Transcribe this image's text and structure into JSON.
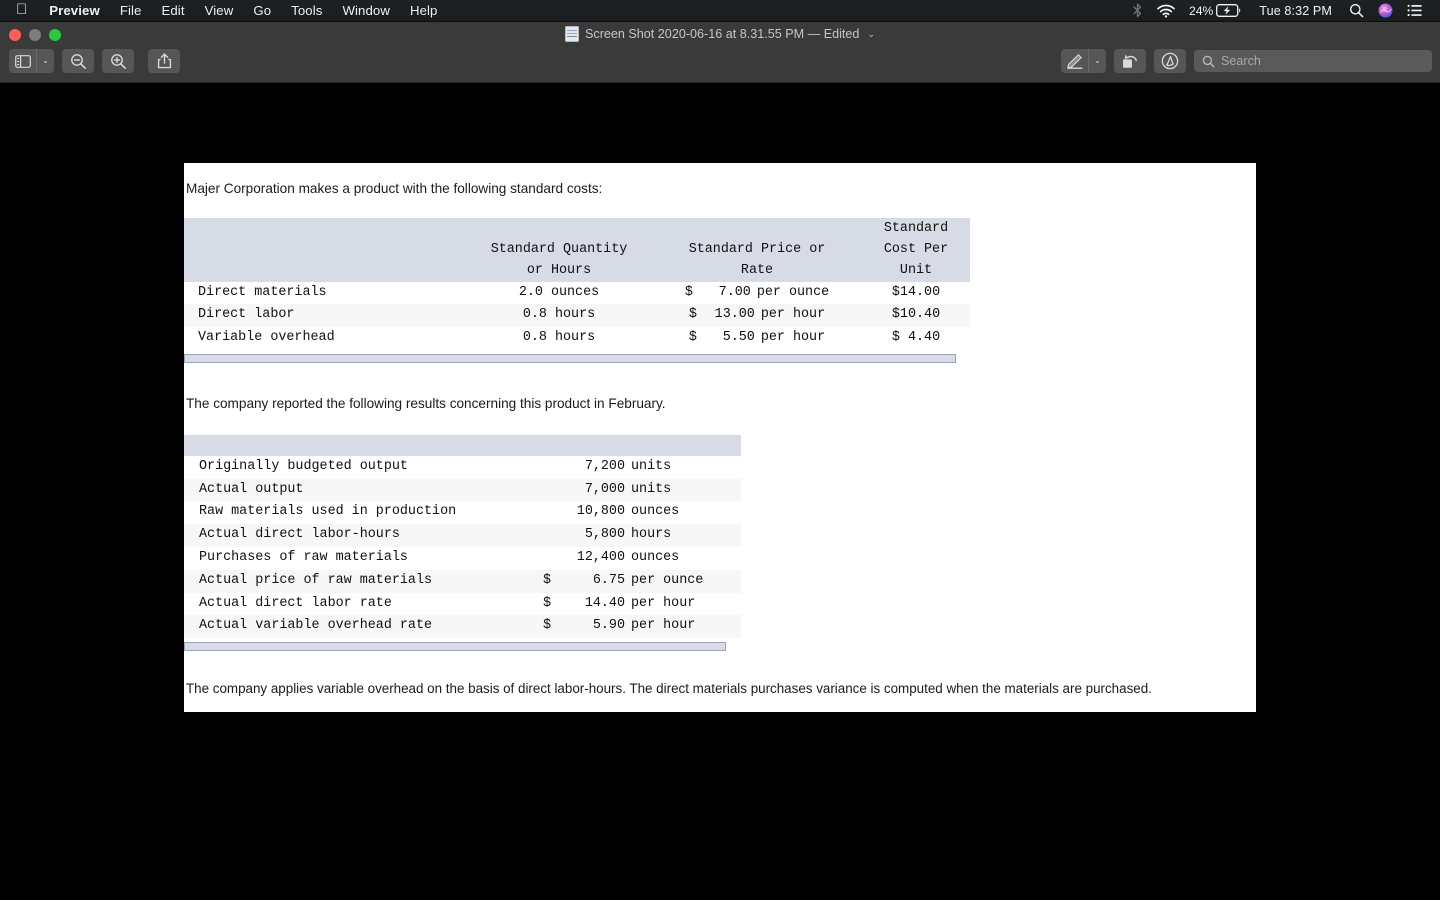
{
  "menubar": {
    "apple_glyph": "apple-logo",
    "items": [
      {
        "label": "Preview",
        "bold": true
      },
      {
        "label": "File",
        "bold": false
      },
      {
        "label": "Edit",
        "bold": false
      },
      {
        "label": "View",
        "bold": false
      },
      {
        "label": "Go",
        "bold": false
      },
      {
        "label": "Tools",
        "bold": false
      },
      {
        "label": "Window",
        "bold": false
      },
      {
        "label": "Help",
        "bold": false
      }
    ],
    "status": {
      "bluetooth_icon": "bluetooth-icon",
      "wifi_icon": "wifi-icon",
      "battery_percent": "24%",
      "battery_icon": "battery-charging-icon",
      "clock": "Tue 8:32 PM",
      "spotlight_icon": "search-icon",
      "siri_icon": "siri-icon",
      "control_center_icon": "control-center-icon"
    }
  },
  "window": {
    "title": "Screen Shot 2020-06-16 at 8.31.55 PM — Edited",
    "title_chevron": "⌄",
    "traffic_lights": [
      "close",
      "minimize",
      "zoom"
    ]
  },
  "toolbar": {
    "sidebar_button": "sidebar-toggle",
    "sidebar_chevron": "⌄",
    "zoom_out_button": "zoom-out",
    "zoom_in_button": "zoom-in",
    "share_button": "share",
    "markup_button": "markup-pen",
    "markup_chevron": "⌄",
    "rotate_button": "rotate-left",
    "annotate_button": "annotate",
    "search_placeholder": "Search"
  },
  "document": {
    "intro_paragraph": "Majer Corporation makes a product with the following standard costs:",
    "mid_paragraph": "The company reported the following results concerning this product in February.",
    "footer_paragraph": "The company applies variable overhead on the basis of direct labor-hours. The direct materials purchases variance is computed when the materials are purchased.",
    "standards_table": {
      "headers": {
        "blank": "",
        "quantity": [
          "Standard Quantity",
          "or Hours"
        ],
        "price": [
          "Standard Price or",
          "Rate"
        ],
        "cost": [
          "Standard",
          "Cost Per",
          "Unit"
        ]
      },
      "rows": [
        {
          "label": "Direct materials",
          "quantity": "2.0 ounces",
          "price_dollar": "$",
          "price_num": "7.00",
          "price_per": "per ounce",
          "cost": "$14.00"
        },
        {
          "label": "Direct labor",
          "quantity": "0.8 hours",
          "price_dollar": "$",
          "price_num": "13.00",
          "price_per": "per hour",
          "cost": "$10.40"
        },
        {
          "label": "Variable overhead",
          "quantity": "0.8 hours",
          "price_dollar": "$",
          "price_num": "5.50",
          "price_per": "per hour",
          "cost": "$ 4.40"
        }
      ]
    },
    "results_table": {
      "rows": [
        {
          "label": "Originally budgeted output",
          "dollar": "",
          "num": "7,200",
          "unit": "units"
        },
        {
          "label": "Actual output",
          "dollar": "",
          "num": "7,000",
          "unit": "units"
        },
        {
          "label": "Raw materials used in production",
          "dollar": "",
          "num": "10,800",
          "unit": "ounces"
        },
        {
          "label": "Actual direct labor-hours",
          "dollar": "",
          "num": "5,800",
          "unit": "hours"
        },
        {
          "label": "Purchases of raw materials",
          "dollar": "",
          "num": "12,400",
          "unit": "ounces"
        },
        {
          "label": "Actual price of raw materials",
          "dollar": "$",
          "num": "6.75",
          "unit": "per ounce"
        },
        {
          "label": "Actual direct labor rate",
          "dollar": "$",
          "num": "14.40",
          "unit": "per hour"
        },
        {
          "label": "Actual variable overhead rate",
          "dollar": "$",
          "num": "5.90",
          "unit": "per hour"
        }
      ]
    }
  },
  "colors": {
    "table_header_bg": "#d7dbe5",
    "row_alt_bg": "#f7f7f7",
    "page_bg": "#ffffff",
    "canvas_bg": "#000000",
    "chrome_bg": "#3a3a3a"
  }
}
